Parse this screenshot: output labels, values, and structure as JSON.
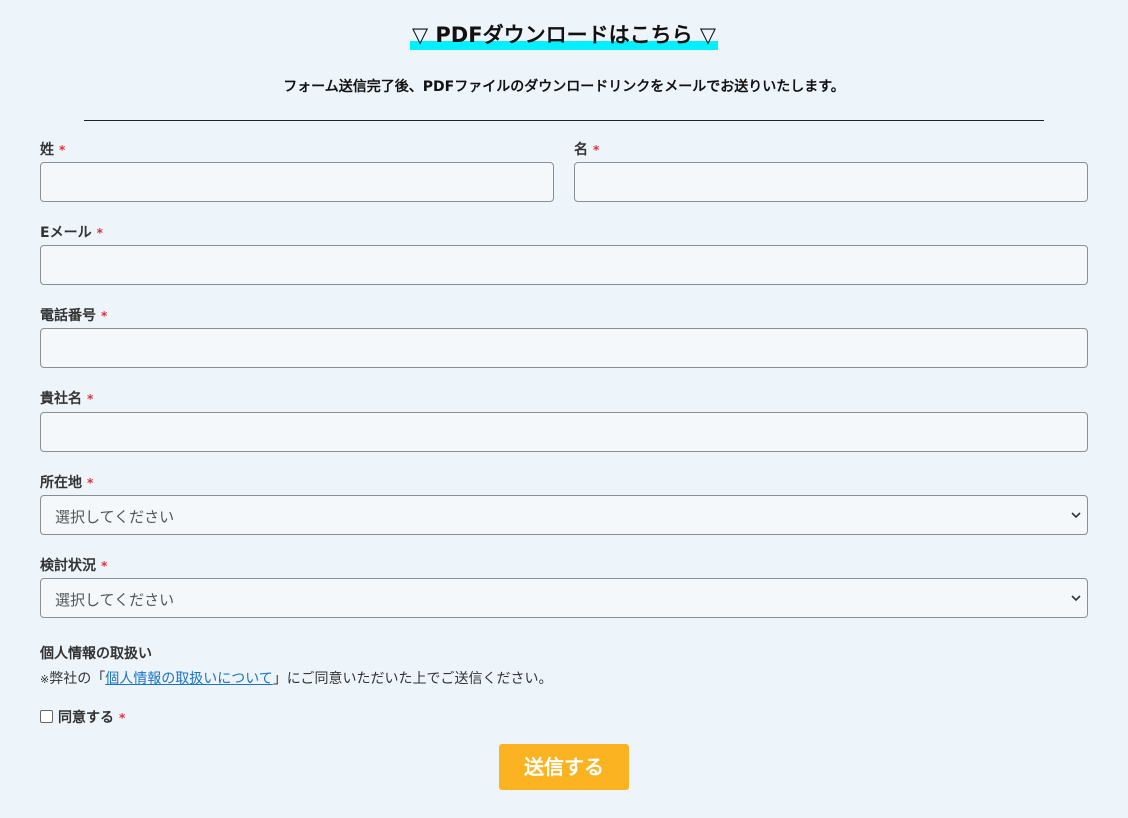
{
  "header": {
    "title": "▽ PDFダウンロードはこちら ▽",
    "subtitle": "フォーム送信完了後、PDFファイルのダウンロードリンクをメールでお送りいたします。"
  },
  "form": {
    "required_mark": "*",
    "last_name_label": "姓",
    "first_name_label": "名",
    "email_label": "Eメール",
    "phone_label": "電話番号",
    "company_label": "貴社名",
    "location_label": "所在地",
    "location_value": "選択してください",
    "status_label": "検討状況",
    "status_value": "選択してください"
  },
  "privacy": {
    "title": "個人情報の取扱い",
    "note_mark": "※",
    "note_prefix": "弊社の「",
    "link_text": "個人情報の取扱いについて",
    "note_suffix": "」にご同意いただいた上でご送信ください。",
    "agree_label": "同意する"
  },
  "submit_label": "送信する",
  "colors": {
    "accent": "#fbb322",
    "highlight": "#00f0ff",
    "required": "#e0303a",
    "background": "#edf4fa"
  }
}
